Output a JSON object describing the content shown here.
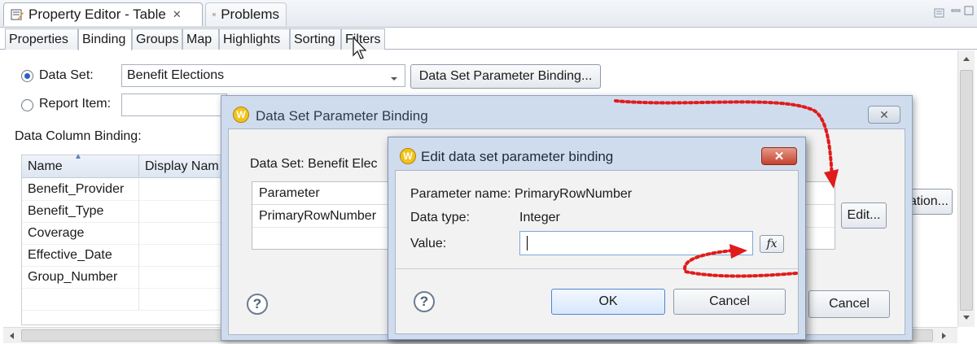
{
  "view_tabs": {
    "property_editor": "Property Editor - Table",
    "problems": "Problems",
    "close": "✕"
  },
  "prop_tabs": [
    "Properties",
    "Binding",
    "Groups",
    "Map",
    "Highlights",
    "Sorting",
    "Filters"
  ],
  "binding": {
    "dataset_label": "Data Set:",
    "dataset_value": "Benefit Elections",
    "dataset_param_button": "Data Set Parameter Binding...",
    "report_item_label": "Report Item:",
    "data_column_binding_label": "Data Column Binding:",
    "columns": [
      "Name",
      "Display Nam"
    ],
    "rows": [
      "Benefit_Provider",
      "Benefit_Type",
      "Coverage",
      "Effective_Date",
      "Group_Number"
    ],
    "right_button_partial": "ation...",
    "sort_indicator": "▲"
  },
  "dlg_param": {
    "title": "Data Set Parameter Binding",
    "dataset_text": "Data Set:  Benefit Elec",
    "col_parameter": "Parameter",
    "row_param": "PrimaryRowNumber",
    "edit_button": "Edit...",
    "cancel_button": "Cancel",
    "help": "?"
  },
  "dlg_edit": {
    "title": "Edit data set parameter binding",
    "param_name": "Parameter name: PrimaryRowNumber",
    "data_type_label": "Data type:",
    "data_type_value": "Integer",
    "value_label": "Value:",
    "value": "",
    "fx_button": "fx",
    "ok_button": "OK",
    "cancel_button": "Cancel",
    "help": "?"
  },
  "colors": {
    "accent": "#2b62c2",
    "arrow": "#e01b1b",
    "dialog_frame": "#cfdcee"
  }
}
